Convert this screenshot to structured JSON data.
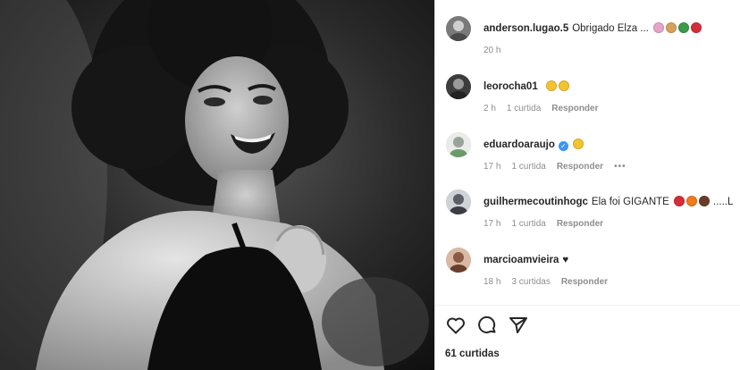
{
  "comments": [
    {
      "user": "anderson.lugao.5",
      "text": "Obrigado Elza ...",
      "emojis": [
        "#e8a3c8",
        "#d6a25b",
        "#3a9a4a",
        "#d62d3a"
      ],
      "time": "20 h",
      "likes": "",
      "reply": "",
      "avatar_color": "#7a7a7a"
    },
    {
      "user": "leorocha01",
      "text": "",
      "emojis": [
        "#f4c430",
        "#f4c430"
      ],
      "time": "2 h",
      "likes": "1 curtida",
      "reply": "Responder",
      "avatar_color": "#3d3d3d"
    },
    {
      "user": "eduardoaraujo",
      "text": "",
      "emojis": [
        "#f4c430"
      ],
      "time": "17 h",
      "likes": "1 curtida",
      "reply": "Responder",
      "avatar_color": "#9aa39a",
      "verified": "✓",
      "more": "•••"
    },
    {
      "user": "guilhermecoutinhogc",
      "text": "Ela foi GIGANTE",
      "emojis": [
        "#d62d3a",
        "#f07b1d",
        "#6b3b2a"
      ],
      "time": "17 h",
      "likes": "1 curtida",
      "reply": "Responder",
      "avatar_color": "#5b5f66",
      "suffix": ".....L"
    },
    {
      "user": "marcioamvieira",
      "text": "♥",
      "emojis": [],
      "time": "18 h",
      "likes": "3 curtidas",
      "reply": "Responder",
      "avatar_color": "#8b5a45"
    }
  ],
  "actions": {
    "like_icon": "heart-icon",
    "comment_icon": "comment-icon",
    "share_icon": "share-icon"
  },
  "likes_count": "61 curtidas"
}
